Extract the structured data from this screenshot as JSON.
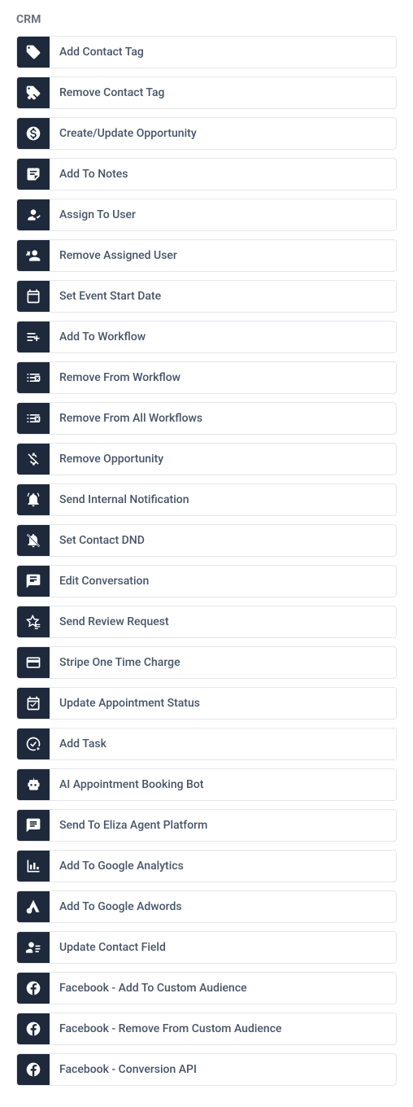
{
  "section": {
    "title": "CRM"
  },
  "actions": [
    {
      "label": "Add Contact Tag",
      "name": "add-contact-tag",
      "icon": "tag-icon"
    },
    {
      "label": "Remove Contact Tag",
      "name": "remove-contact-tag",
      "icon": "tag-remove-icon"
    },
    {
      "label": "Create/Update Opportunity",
      "name": "create-update-opportunity",
      "icon": "dollar-circle-icon"
    },
    {
      "label": "Add To Notes",
      "name": "add-to-notes",
      "icon": "note-icon"
    },
    {
      "label": "Assign To User",
      "name": "assign-to-user",
      "icon": "user-check-icon"
    },
    {
      "label": "Remove Assigned User",
      "name": "remove-assigned-user",
      "icon": "user-remove-icon"
    },
    {
      "label": "Set Event Start Date",
      "name": "set-event-start-date",
      "icon": "calendar-icon"
    },
    {
      "label": "Add To Workflow",
      "name": "add-to-workflow",
      "icon": "list-add-icon"
    },
    {
      "label": "Remove From Workflow",
      "name": "remove-from-workflow",
      "icon": "list-remove-icon"
    },
    {
      "label": "Remove From All Workflows",
      "name": "remove-from-all-workflows",
      "icon": "list-remove-icon"
    },
    {
      "label": "Remove Opportunity",
      "name": "remove-opportunity",
      "icon": "dollar-remove-icon"
    },
    {
      "label": "Send Internal Notification",
      "name": "send-internal-notification",
      "icon": "bell-icon"
    },
    {
      "label": "Set Contact DND",
      "name": "set-contact-dnd",
      "icon": "bell-slash-icon"
    },
    {
      "label": "Edit Conversation",
      "name": "edit-conversation",
      "icon": "conversation-icon"
    },
    {
      "label": "Send Review Request",
      "name": "send-review-request",
      "icon": "star-list-icon"
    },
    {
      "label": "Stripe One Time Charge",
      "name": "stripe-one-time-charge",
      "icon": "credit-card-icon"
    },
    {
      "label": "Update Appointment Status",
      "name": "update-appointment-status",
      "icon": "calendar-check-icon"
    },
    {
      "label": "Add Task",
      "name": "add-task",
      "icon": "task-add-icon"
    },
    {
      "label": "AI Appointment Booking Bot",
      "name": "ai-appointment-booking-bot",
      "icon": "robot-icon"
    },
    {
      "label": "Send To Eliza Agent Platform",
      "name": "send-to-eliza-agent-platform",
      "icon": "chat-icon"
    },
    {
      "label": "Add To Google Analytics",
      "name": "add-to-google-analytics",
      "icon": "analytics-icon"
    },
    {
      "label": "Add To Google Adwords",
      "name": "add-to-google-adwords",
      "icon": "adwords-icon"
    },
    {
      "label": "Update Contact Field",
      "name": "update-contact-field",
      "icon": "user-list-icon"
    },
    {
      "label": "Facebook - Add To Custom Audience",
      "name": "facebook-add-to-custom-audience",
      "icon": "facebook-icon"
    },
    {
      "label": "Facebook - Remove From Custom Audience",
      "name": "facebook-remove-from-custom-audience",
      "icon": "facebook-icon"
    },
    {
      "label": "Facebook - Conversion API",
      "name": "facebook-conversion-api",
      "icon": "facebook-icon"
    }
  ]
}
